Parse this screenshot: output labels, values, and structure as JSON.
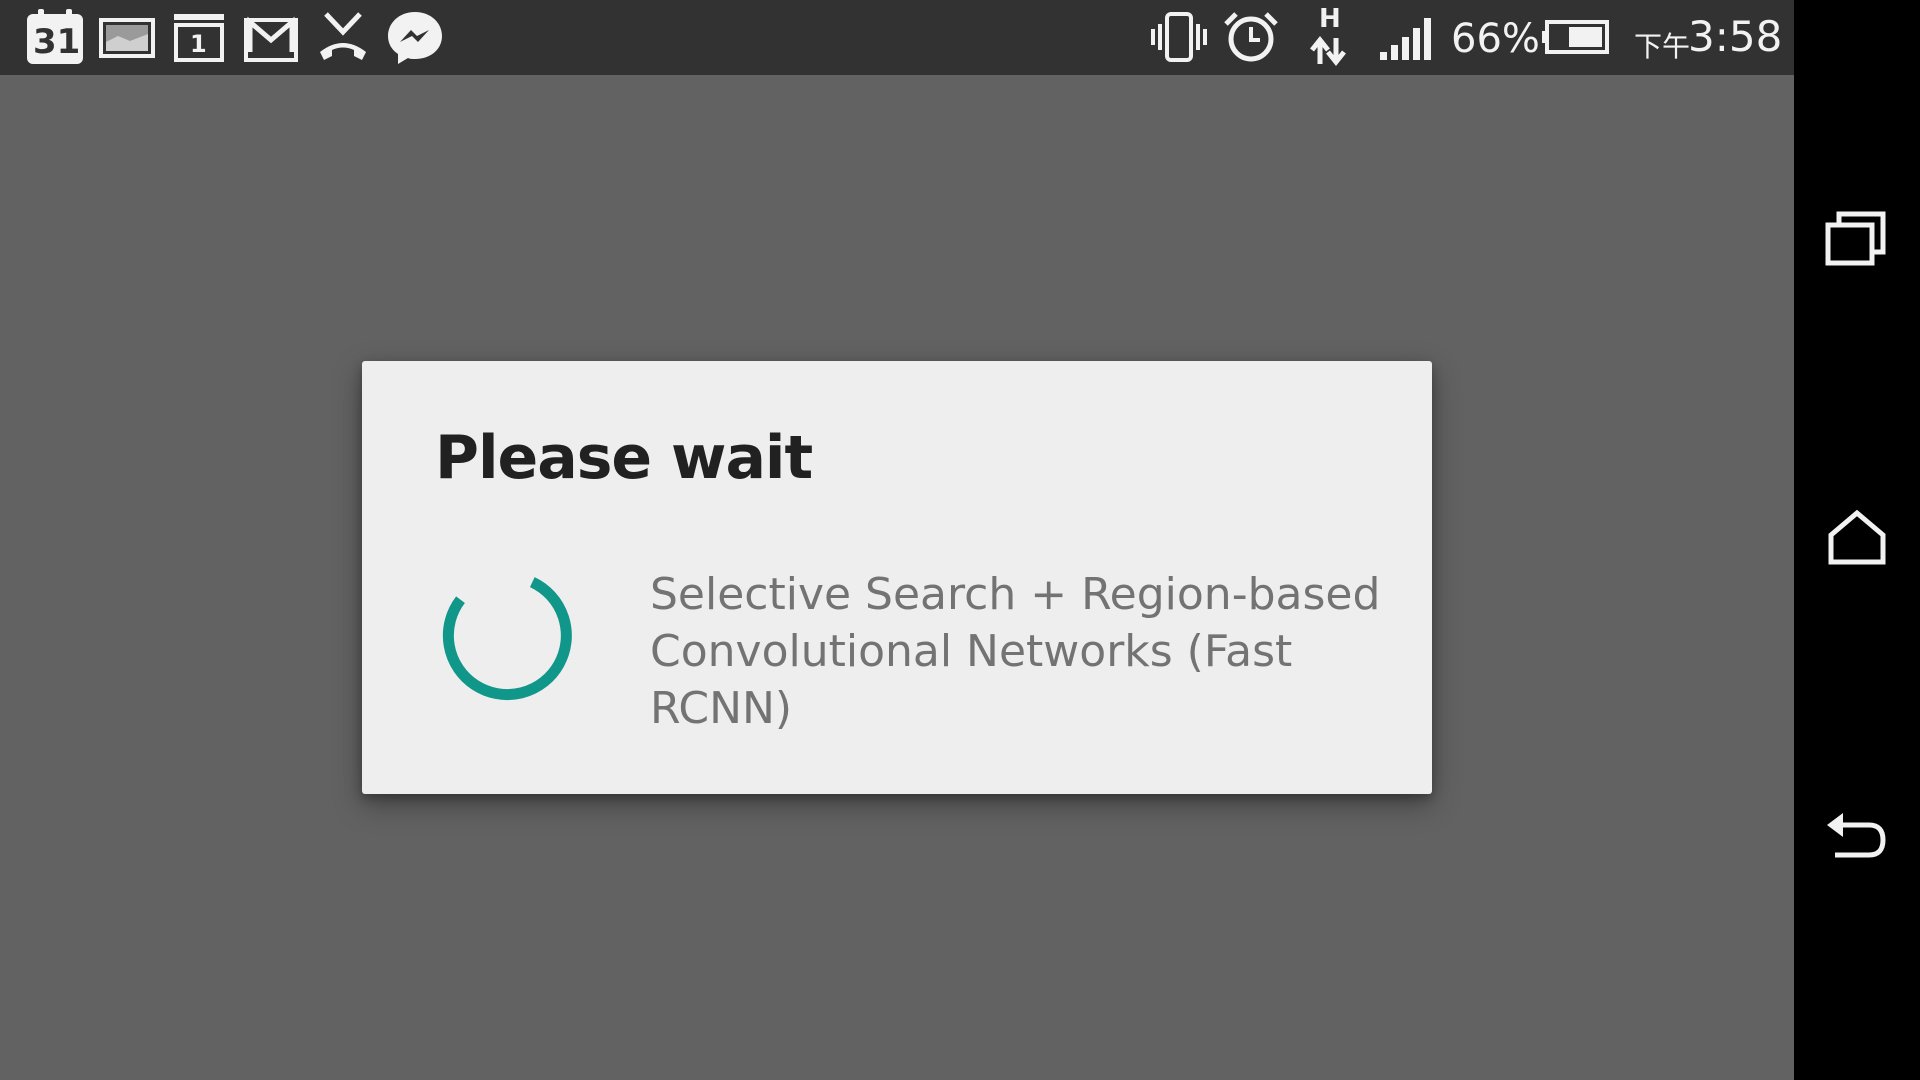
{
  "status_bar": {
    "left_icons": [
      "calendar-icon",
      "gallery-icon",
      "calendar-day-icon",
      "gmail-icon",
      "missed-call-icon",
      "messenger-icon"
    ],
    "calendar_day": "31",
    "calendar_small_day": "1",
    "network_type": "H",
    "battery_percent": "66%",
    "battery_level": 0.66,
    "time_prefix": "下午",
    "time": "3:58",
    "right_icons": [
      "vibrate-icon",
      "alarm-icon",
      "data-arrows-icon",
      "signal-icon",
      "battery-icon"
    ]
  },
  "dialog": {
    "title": "Please wait",
    "message": "Selective Search + Region-based Convolutional Networks (Fast RCNN)",
    "spinner_color": "#11968a"
  },
  "nav_bar": {
    "buttons": [
      "recent-apps-button",
      "home-button",
      "back-button"
    ]
  }
}
